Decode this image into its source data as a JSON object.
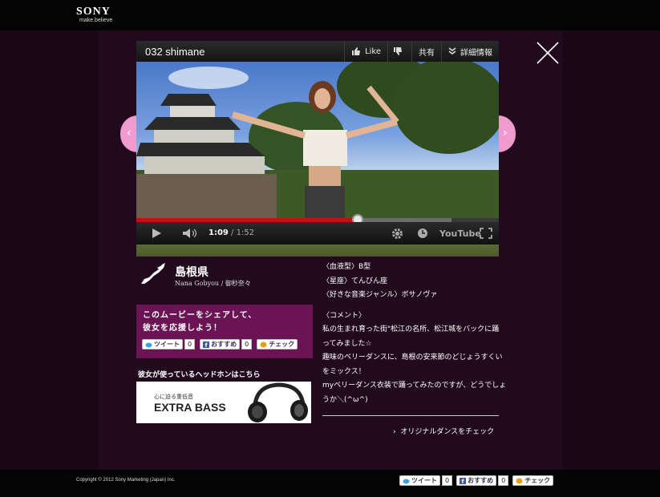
{
  "header": {
    "logo": "SONY",
    "tagline": "make.believe"
  },
  "video": {
    "title": "032 shimane",
    "like_label": "Like",
    "share_label": "共有",
    "details_label": "詳細情報",
    "time_current": "1:09",
    "time_sep": " / ",
    "time_total": "1:52",
    "progress_played": 0.61,
    "progress_loaded": 0.87,
    "youtube_label": "YouTube"
  },
  "nav": {
    "prev": "‹",
    "next": "›"
  },
  "profile": {
    "prefecture": "島根県",
    "artist": "Nana Gobyou / 御秒奈々"
  },
  "share_box": {
    "line1": "このムービーをシェアして、",
    "line2": "彼女を応援しよう！",
    "tweet_label": "ツイート",
    "tweet_count": "0",
    "recommend_label": "おすすめ",
    "recommend_count": "0",
    "check_label": "チェック"
  },
  "headphones": {
    "label": "彼女が使っているヘッドホンはこちら",
    "banner_sub": "心に迫る重低音",
    "banner_main": "EXTRA BASS"
  },
  "info": {
    "blood": "〈血液型〉B型",
    "sign": "〈星座〉てんびん座",
    "genre": "〈好きな音楽ジャンル〉ボサノヴァ",
    "comment_heading": "〈コメント〉",
    "comment_lines": [
      "私の生まれ育った街\"松江の名所、松江城をバックに踊",
      "ってみました☆",
      "趣味のベリーダンスに、島根の安来節のどじょうすくい",
      "をミックス！",
      "myベリーダンス衣装で踊ってみたのですが、どうでしょ",
      "うか＼(^ω^)"
    ],
    "check_link": "オリジナルダンスをチェック"
  },
  "footer": {
    "copyright": "Copyright © 2012 Sony Marketing (Japan) Inc.",
    "tweet_label": "ツイート",
    "tweet_count": "0",
    "recommend_label": "おすすめ",
    "recommend_count": "0",
    "check_label": "チェック"
  },
  "colors": {
    "accent_pink": "#f09bd0",
    "share_box": "#6b1454",
    "progress": "#c41010"
  }
}
